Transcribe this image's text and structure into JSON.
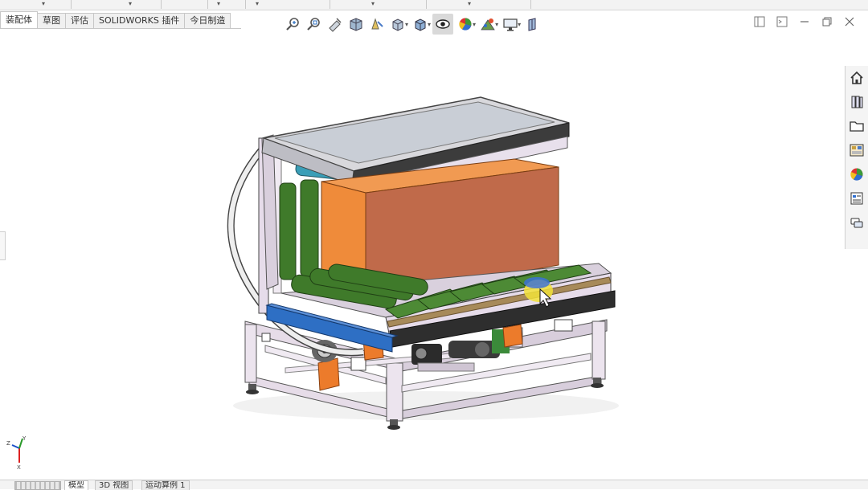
{
  "command_tabs": [
    {
      "label": "装配体",
      "active": true
    },
    {
      "label": "草图",
      "active": false
    },
    {
      "label": "评估",
      "active": false
    },
    {
      "label": "SOLIDWORKS 插件",
      "active": false
    },
    {
      "label": "今日制造",
      "active": false
    }
  ],
  "view_toolbar": {
    "buttons": [
      {
        "name": "zoom-to-fit-icon"
      },
      {
        "name": "zoom-to-area-icon"
      },
      {
        "name": "previous-view-icon"
      },
      {
        "name": "section-view-icon"
      },
      {
        "name": "dynamic-annotation-icon"
      },
      {
        "name": "view-orientation-icon"
      },
      {
        "name": "display-style-icon"
      },
      {
        "name": "hide-show-items-icon"
      },
      {
        "name": "edit-appearance-icon"
      },
      {
        "name": "apply-scene-icon"
      },
      {
        "name": "view-settings-icon"
      },
      {
        "name": "display-pane-icon"
      }
    ]
  },
  "task_pane": [
    {
      "name": "home-icon"
    },
    {
      "name": "design-library-icon"
    },
    {
      "name": "file-explorer-icon"
    },
    {
      "name": "view-palette-icon"
    },
    {
      "name": "appearances-scenes-icon"
    },
    {
      "name": "custom-properties-icon"
    },
    {
      "name": "forum-icon"
    }
  ],
  "triad": {
    "x": "X",
    "y": "Y",
    "z": "Z"
  },
  "bottom_tabs": [
    {
      "label": "模型",
      "active": true
    },
    {
      "label": "3D 视图",
      "active": false
    },
    {
      "label": "运动算例 1",
      "active": false
    }
  ],
  "colors": {
    "roller_green": "#3f7a2a",
    "box_orange": "#e07a34",
    "frame_lilac": "#e4dbe8",
    "accent_blue": "#2e6fc4",
    "teal_roller": "#3a9eb7",
    "orange_bracket": "#ec7b2b"
  }
}
